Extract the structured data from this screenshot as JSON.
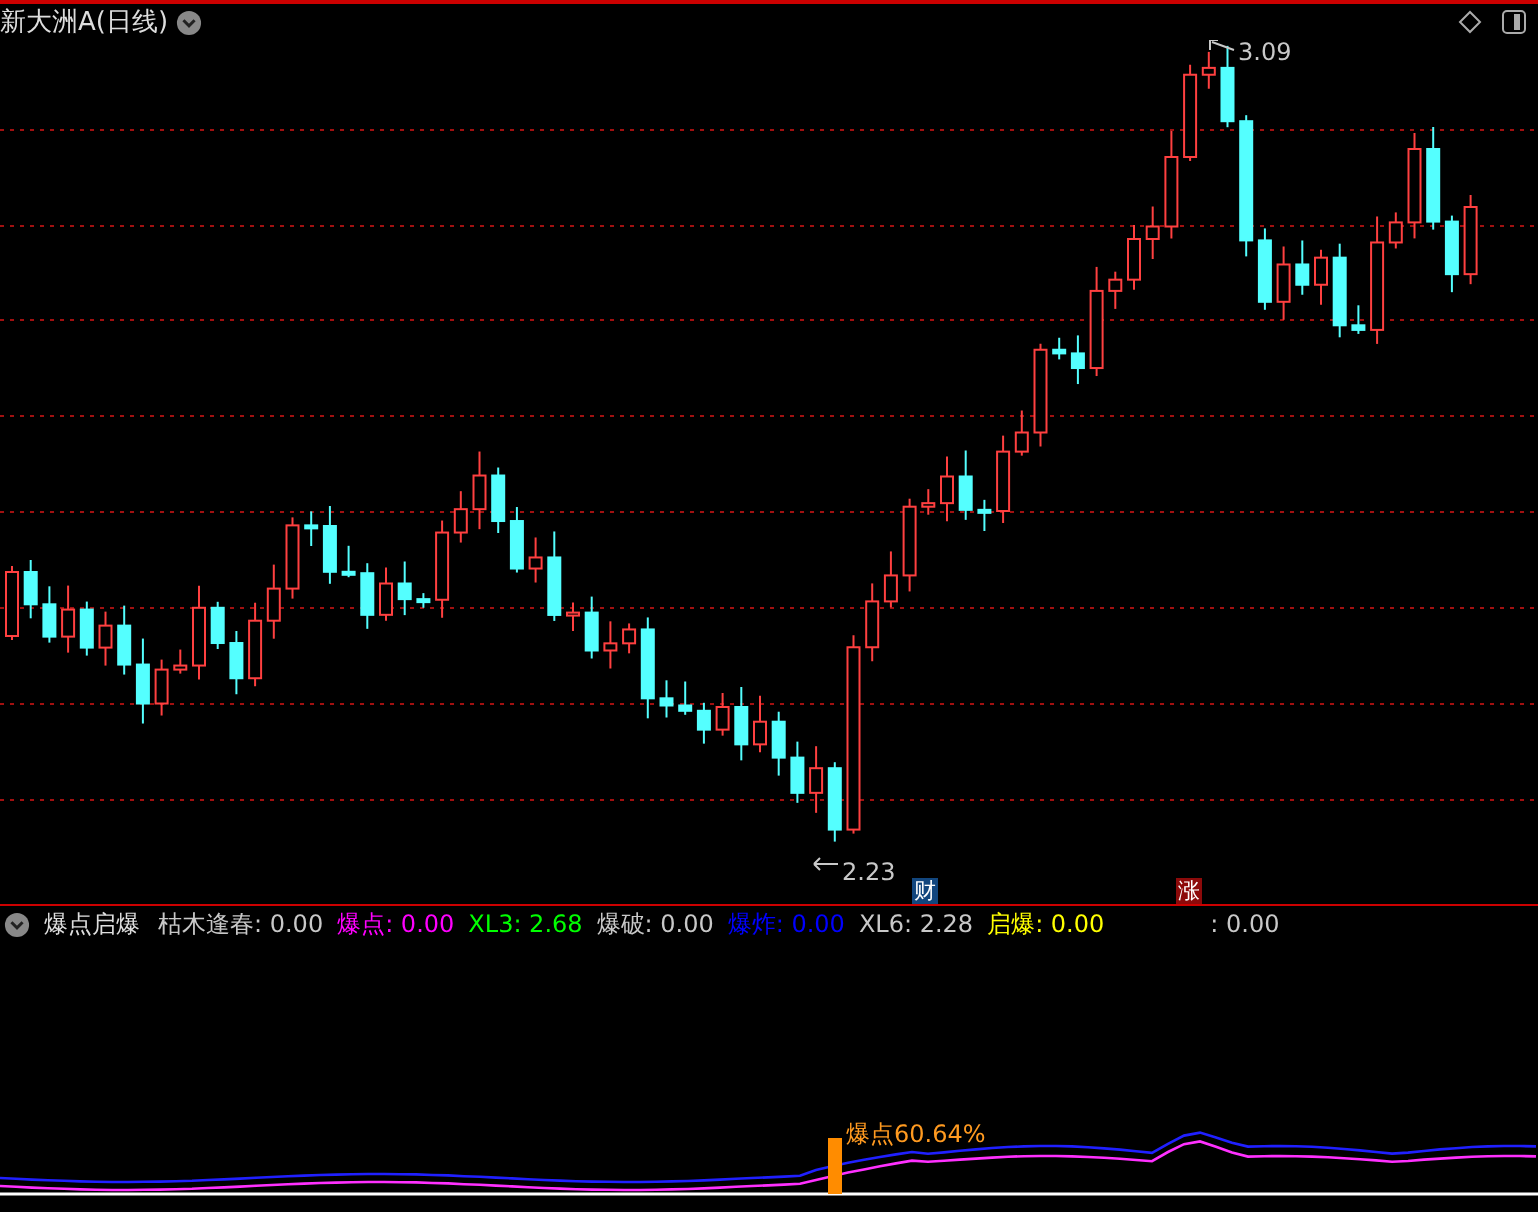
{
  "title": "新大洲A(日线)",
  "main_chart": {
    "high_label": "3.09",
    "low_label": "2.23",
    "markers": [
      {
        "text": "财",
        "color": "#12467e"
      },
      {
        "text": "涨",
        "color": "#8c0a0a"
      }
    ]
  },
  "indicator": {
    "name": "爆点启爆",
    "items": [
      {
        "text": "枯木逢春: 0.00",
        "color": "#c8c8c8",
        "kind": "inline"
      },
      {
        "text": "爆点: 0.00",
        "color": "#ff00ff",
        "kind": "inline"
      },
      {
        "text": "XL3: 2.68",
        "color": "#00ff00",
        "kind": "inline"
      },
      {
        "text": "爆破: 0.00",
        "color": "#c8c8c8",
        "kind": "inline"
      },
      {
        "text": "爆炸: 0.00",
        "color": "#0000ff",
        "kind": "inline"
      },
      {
        "text": "XL6: 2.28",
        "color": "#c8c8c8",
        "kind": "inline"
      },
      {
        "text": "启爆: 0.00",
        "color": "#ffff00",
        "kind": "inline"
      },
      {
        "text": ": 0.00",
        "color": "#c8c8c8",
        "kind": "detached"
      }
    ],
    "signal_label": "爆点60.64%"
  }
}
